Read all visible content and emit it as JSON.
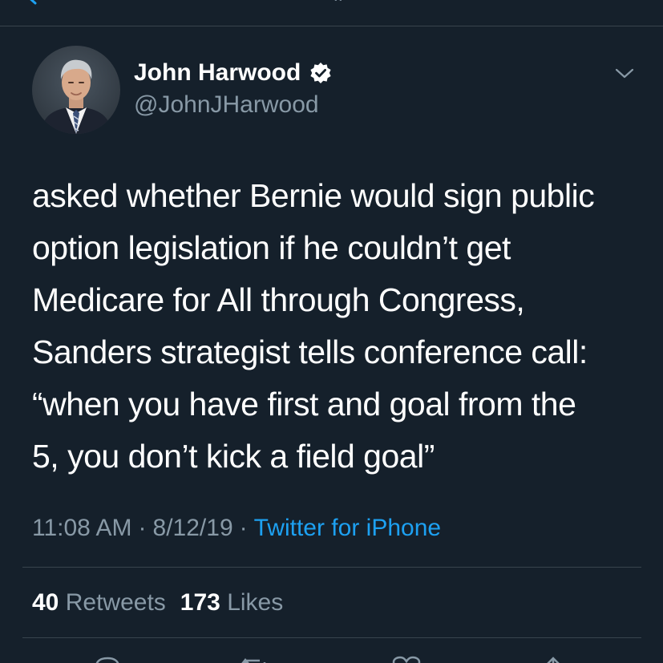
{
  "tweet": {
    "author_name": "John Harwood",
    "author_handle": "@JohnJHarwood",
    "verified": true,
    "text": "asked whether Bernie would sign public\noption legislation if he couldn’t get\nMedicare for All through Congress,\nSanders strategist tells conference call:\n“when you have first and goal from the\n5, you don’t kick a field goal”",
    "time": "11:08 AM",
    "separator": "·",
    "date": "8/12/19",
    "source": "Twitter for iPhone",
    "retweets_count": "40",
    "retweets_label": "Retweets",
    "likes_count": "173",
    "likes_label": "Likes"
  },
  "icons": {
    "back": "chevron-left-icon",
    "verified": "verified-badge-icon",
    "more": "chevron-down-icon",
    "reply": "reply-icon",
    "retweet": "retweet-icon",
    "like": "heart-icon",
    "share": "share-icon"
  },
  "colors": {
    "background": "#15202b",
    "text_primary": "#ffffff",
    "text_secondary": "#8899a6",
    "accent": "#1da1f2",
    "divider": "#38444d"
  }
}
